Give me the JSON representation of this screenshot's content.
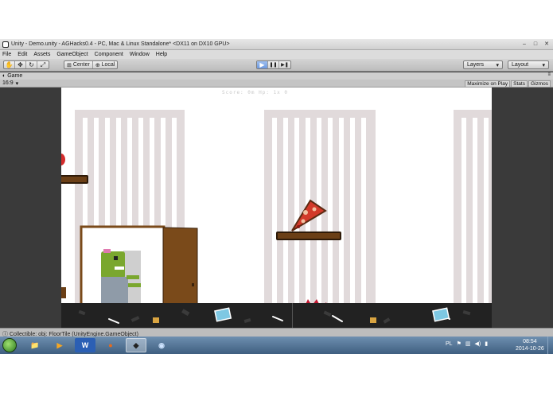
{
  "window": {
    "title": "Unity - Demo.unity - AGHacks0.4 - PC, Mac & Linux Standalone* <DX11 on DX10 GPU>",
    "controls": [
      "–",
      "□",
      "✕"
    ]
  },
  "menubar": {
    "items": [
      "File",
      "Edit",
      "Assets",
      "GameObject",
      "Component",
      "Window",
      "Help"
    ]
  },
  "toolbar": {
    "tools": [
      {
        "icon": "hand-icon",
        "glyph": "✋"
      },
      {
        "icon": "move-icon",
        "glyph": "✥"
      },
      {
        "icon": "rotate-icon",
        "glyph": "↻"
      },
      {
        "icon": "scale-icon",
        "glyph": "⤢"
      }
    ],
    "pivot_label": "Center",
    "space_label": "Local",
    "play": {
      "play_glyph": "▶",
      "pause_glyph": "❚❚",
      "step_glyph": "▶❚",
      "play_active": true
    },
    "layers_label": "Layers",
    "layout_label": "Layout"
  },
  "game_panel": {
    "tab_label": "Game",
    "aspect_label": "16:9",
    "options": [
      "Maximize on Play",
      "Stats",
      "Gizmos"
    ],
    "score_text": "Score: 0m  Hp: 1x 0"
  },
  "status_bar": {
    "message": "Collectible: obj: FloorTile (UnityEngine.GameObject)"
  },
  "taskbar": {
    "apps": [
      {
        "name": "explorer",
        "glyph": "📁",
        "color": "#f2d27a"
      },
      {
        "name": "media-player",
        "glyph": "▶",
        "color": "#f5a623"
      },
      {
        "name": "word",
        "glyph": "W",
        "color": "#2b5fb4"
      },
      {
        "name": "firefox",
        "glyph": "●",
        "color": "#e86a1a"
      },
      {
        "name": "unity",
        "glyph": "◆",
        "color": "#222222"
      },
      {
        "name": "remote",
        "glyph": "◉",
        "color": "#6aa0d8"
      }
    ],
    "language": "PL",
    "time": "08:54",
    "date": "2014-10-26"
  },
  "colors": {
    "shelf": "#6b3f16",
    "zombie_skin": "#7aa72e",
    "dino": "#c41a33",
    "door": "#7a4a1a",
    "floor": "#222222"
  }
}
